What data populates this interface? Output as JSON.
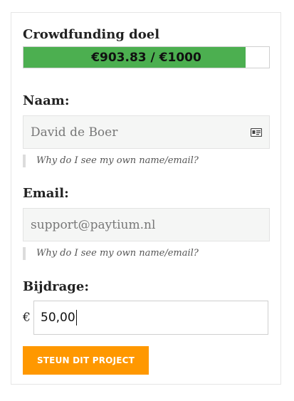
{
  "goal": {
    "title": "Crowdfunding doel",
    "progress_text": "€903.83 / €1000",
    "raised": 903.83,
    "target": 1000,
    "fill_color": "#4caf50"
  },
  "name_field": {
    "label": "Naam:",
    "value": "David de Boer",
    "icon": "id-card-icon",
    "hint": "Why do I see my own name/email?"
  },
  "email_field": {
    "label": "Email:",
    "value": "support@paytium.nl",
    "hint": "Why do I see my own name/email?"
  },
  "amount_field": {
    "label": "Bijdrage:",
    "currency": "€",
    "value": "50,00"
  },
  "submit": {
    "label": "STEUN DIT PROJECT",
    "color": "#ff9800"
  }
}
